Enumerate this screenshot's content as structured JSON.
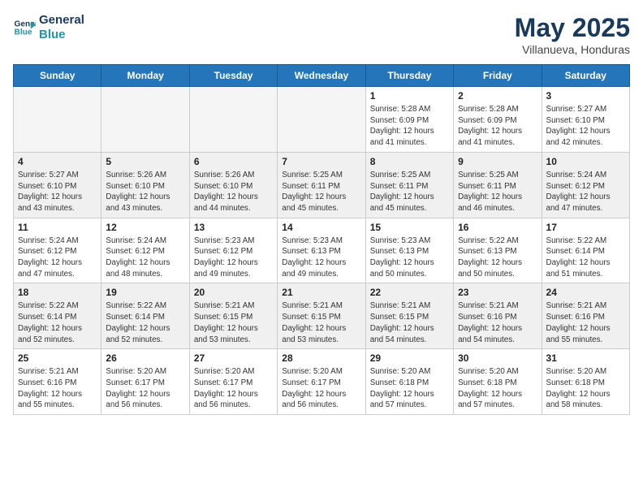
{
  "header": {
    "logo_line1": "General",
    "logo_line2": "Blue",
    "title": "May 2025",
    "subtitle": "Villanueva, Honduras"
  },
  "weekdays": [
    "Sunday",
    "Monday",
    "Tuesday",
    "Wednesday",
    "Thursday",
    "Friday",
    "Saturday"
  ],
  "weeks": [
    [
      {
        "day": "",
        "info": ""
      },
      {
        "day": "",
        "info": ""
      },
      {
        "day": "",
        "info": ""
      },
      {
        "day": "",
        "info": ""
      },
      {
        "day": "1",
        "info": "Sunrise: 5:28 AM\nSunset: 6:09 PM\nDaylight: 12 hours\nand 41 minutes."
      },
      {
        "day": "2",
        "info": "Sunrise: 5:28 AM\nSunset: 6:09 PM\nDaylight: 12 hours\nand 41 minutes."
      },
      {
        "day": "3",
        "info": "Sunrise: 5:27 AM\nSunset: 6:10 PM\nDaylight: 12 hours\nand 42 minutes."
      }
    ],
    [
      {
        "day": "4",
        "info": "Sunrise: 5:27 AM\nSunset: 6:10 PM\nDaylight: 12 hours\nand 43 minutes."
      },
      {
        "day": "5",
        "info": "Sunrise: 5:26 AM\nSunset: 6:10 PM\nDaylight: 12 hours\nand 43 minutes."
      },
      {
        "day": "6",
        "info": "Sunrise: 5:26 AM\nSunset: 6:10 PM\nDaylight: 12 hours\nand 44 minutes."
      },
      {
        "day": "7",
        "info": "Sunrise: 5:25 AM\nSunset: 6:11 PM\nDaylight: 12 hours\nand 45 minutes."
      },
      {
        "day": "8",
        "info": "Sunrise: 5:25 AM\nSunset: 6:11 PM\nDaylight: 12 hours\nand 45 minutes."
      },
      {
        "day": "9",
        "info": "Sunrise: 5:25 AM\nSunset: 6:11 PM\nDaylight: 12 hours\nand 46 minutes."
      },
      {
        "day": "10",
        "info": "Sunrise: 5:24 AM\nSunset: 6:12 PM\nDaylight: 12 hours\nand 47 minutes."
      }
    ],
    [
      {
        "day": "11",
        "info": "Sunrise: 5:24 AM\nSunset: 6:12 PM\nDaylight: 12 hours\nand 47 minutes."
      },
      {
        "day": "12",
        "info": "Sunrise: 5:24 AM\nSunset: 6:12 PM\nDaylight: 12 hours\nand 48 minutes."
      },
      {
        "day": "13",
        "info": "Sunrise: 5:23 AM\nSunset: 6:12 PM\nDaylight: 12 hours\nand 49 minutes."
      },
      {
        "day": "14",
        "info": "Sunrise: 5:23 AM\nSunset: 6:13 PM\nDaylight: 12 hours\nand 49 minutes."
      },
      {
        "day": "15",
        "info": "Sunrise: 5:23 AM\nSunset: 6:13 PM\nDaylight: 12 hours\nand 50 minutes."
      },
      {
        "day": "16",
        "info": "Sunrise: 5:22 AM\nSunset: 6:13 PM\nDaylight: 12 hours\nand 50 minutes."
      },
      {
        "day": "17",
        "info": "Sunrise: 5:22 AM\nSunset: 6:14 PM\nDaylight: 12 hours\nand 51 minutes."
      }
    ],
    [
      {
        "day": "18",
        "info": "Sunrise: 5:22 AM\nSunset: 6:14 PM\nDaylight: 12 hours\nand 52 minutes."
      },
      {
        "day": "19",
        "info": "Sunrise: 5:22 AM\nSunset: 6:14 PM\nDaylight: 12 hours\nand 52 minutes."
      },
      {
        "day": "20",
        "info": "Sunrise: 5:21 AM\nSunset: 6:15 PM\nDaylight: 12 hours\nand 53 minutes."
      },
      {
        "day": "21",
        "info": "Sunrise: 5:21 AM\nSunset: 6:15 PM\nDaylight: 12 hours\nand 53 minutes."
      },
      {
        "day": "22",
        "info": "Sunrise: 5:21 AM\nSunset: 6:15 PM\nDaylight: 12 hours\nand 54 minutes."
      },
      {
        "day": "23",
        "info": "Sunrise: 5:21 AM\nSunset: 6:16 PM\nDaylight: 12 hours\nand 54 minutes."
      },
      {
        "day": "24",
        "info": "Sunrise: 5:21 AM\nSunset: 6:16 PM\nDaylight: 12 hours\nand 55 minutes."
      }
    ],
    [
      {
        "day": "25",
        "info": "Sunrise: 5:21 AM\nSunset: 6:16 PM\nDaylight: 12 hours\nand 55 minutes."
      },
      {
        "day": "26",
        "info": "Sunrise: 5:20 AM\nSunset: 6:17 PM\nDaylight: 12 hours\nand 56 minutes."
      },
      {
        "day": "27",
        "info": "Sunrise: 5:20 AM\nSunset: 6:17 PM\nDaylight: 12 hours\nand 56 minutes."
      },
      {
        "day": "28",
        "info": "Sunrise: 5:20 AM\nSunset: 6:17 PM\nDaylight: 12 hours\nand 56 minutes."
      },
      {
        "day": "29",
        "info": "Sunrise: 5:20 AM\nSunset: 6:18 PM\nDaylight: 12 hours\nand 57 minutes."
      },
      {
        "day": "30",
        "info": "Sunrise: 5:20 AM\nSunset: 6:18 PM\nDaylight: 12 hours\nand 57 minutes."
      },
      {
        "day": "31",
        "info": "Sunrise: 5:20 AM\nSunset: 6:18 PM\nDaylight: 12 hours\nand 58 minutes."
      }
    ]
  ]
}
